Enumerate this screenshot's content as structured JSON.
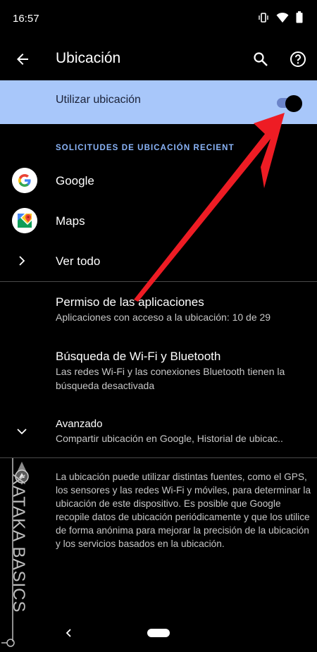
{
  "status_bar": {
    "time": "16:57",
    "icons": [
      "vibrate-icon",
      "wifi-icon",
      "battery-icon"
    ]
  },
  "app_bar": {
    "title": "Ubicación",
    "icons": [
      "back-arrow-icon",
      "search-icon",
      "help-icon"
    ]
  },
  "main_toggle": {
    "label": "Utilizar ubicación",
    "state": "on"
  },
  "recent_requests": {
    "header": "SOLICITUDES DE UBICACIÓN RECIENT",
    "items": [
      {
        "label": "Google",
        "icon": "google-logo-icon"
      },
      {
        "label": "Maps",
        "icon": "maps-logo-icon"
      }
    ],
    "see_all": "Ver todo"
  },
  "settings": {
    "app_permissions": {
      "title": "Permiso de las aplicaciones",
      "subtitle": "Aplicaciones con acceso a la ubicación: 10 de 29"
    },
    "wifi_bt_scan": {
      "title": "Búsqueda de Wi-Fi y Bluetooth",
      "subtitle_line1": "Las redes Wi-Fi y las conexiones Bluetooth tienen la",
      "subtitle_line2": "búsqueda desactivada"
    },
    "advanced": {
      "title": "Avanzado",
      "subtitle": "Compartir ubicación en Google, Historial de ubicac.."
    }
  },
  "info_text": "La ubicación puede utilizar distintas fuentes, como el GPS, los sensores y las redes Wi-Fi y móviles, para determinar la ubicación de este dispositivo. Es posible que Google recopile datos de ubicación periódicamente y que los utilice de forma anónima para mejorar la precisión de la ubicación y los servicios basados en la ubicación.",
  "watermark": "XATAKA BASICS",
  "colors": {
    "background": "#000000",
    "toggle_row": "#a8c7fa",
    "section_header": "#8ab4f8",
    "annotation_arrow": "#ee1c24"
  }
}
